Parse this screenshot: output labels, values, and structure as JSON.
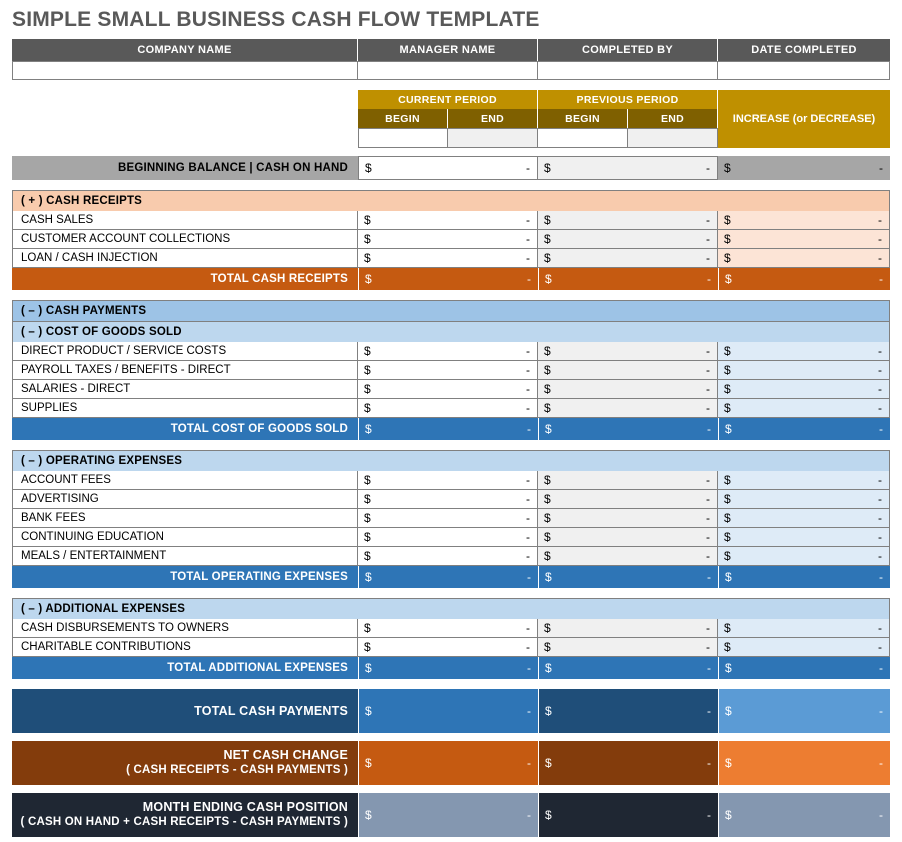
{
  "title": "SIMPLE SMALL BUSINESS CASH FLOW TEMPLATE",
  "info_header": {
    "company_name": "COMPANY NAME",
    "manager_name": "MANAGER NAME",
    "completed_by": "COMPLETED BY",
    "date_completed": "DATE COMPLETED"
  },
  "info_values": {
    "company_name": "",
    "manager_name": "",
    "completed_by": "",
    "date_completed": ""
  },
  "period_header": {
    "current_period": "CURRENT PERIOD",
    "previous_period": "PREVIOUS PERIOD",
    "begin": "BEGIN",
    "end": "END",
    "increase": "INCREASE (or DECREASE)",
    "values": {
      "current_begin": "",
      "current_end": "",
      "previous_begin": "",
      "previous_end": ""
    }
  },
  "money": {
    "symbol": "$",
    "value": "-"
  },
  "beginning_balance": {
    "label": "BEGINNING BALANCE | CASH ON HAND",
    "current": "-",
    "previous": "-",
    "increase": "-"
  },
  "sections": [
    {
      "header": "( + )  CASH RECEIPTS",
      "items": [
        {
          "label": "CASH SALES"
        },
        {
          "label": "CUSTOMER ACCOUNT COLLECTIONS"
        },
        {
          "label": "LOAN / CASH INJECTION"
        }
      ],
      "total": "TOTAL CASH RECEIPTS"
    },
    {
      "header": "( – )  CASH PAYMENTS",
      "subheader": "( – )  COST OF GOODS SOLD",
      "items": [
        {
          "label": "DIRECT PRODUCT / SERVICE COSTS"
        },
        {
          "label": "PAYROLL TAXES / BENEFITS - DIRECT"
        },
        {
          "label": "SALARIES - DIRECT"
        },
        {
          "label": "SUPPLIES"
        }
      ],
      "total": "TOTAL COST OF GOODS SOLD"
    },
    {
      "header": "( – )  OPERATING EXPENSES",
      "items": [
        {
          "label": "ACCOUNT FEES"
        },
        {
          "label": "ADVERTISING"
        },
        {
          "label": "BANK FEES"
        },
        {
          "label": "CONTINUING EDUCATION"
        },
        {
          "label": "MEALS / ENTERTAINMENT"
        }
      ],
      "total": "TOTAL OPERATING EXPENSES"
    },
    {
      "header": "( – )  ADDITIONAL EXPENSES",
      "items": [
        {
          "label": "CASH DISBURSEMENTS TO OWNERS"
        },
        {
          "label": "CHARITABLE CONTRIBUTIONS"
        }
      ],
      "total": "TOTAL ADDITIONAL EXPENSES"
    }
  ],
  "summary": {
    "total_cash_payments": {
      "label": "TOTAL CASH PAYMENTS",
      "sub": ""
    },
    "net_cash_change": {
      "label": "NET CASH CHANGE",
      "sub": "( CASH RECEIPTS - CASH PAYMENTS )"
    },
    "month_ending": {
      "label": "MONTH ENDING CASH POSITION",
      "sub": "( CASH ON HAND + CASH RECEIPTS - CASH PAYMENTS )"
    }
  },
  "colors": {
    "title": "#595959",
    "info_header": "#595959",
    "gold": "#BF9000",
    "gold_dark": "#7F6000",
    "gray": "#A6A6A6",
    "peach": "#F8CBAD",
    "peach_light": "#FCE4D6",
    "orange": "#C55A11",
    "orange_light": "#ED7D31",
    "brown": "#833C0C",
    "blue_med": "#9DC3E6",
    "blue_light": "#BDD7EE",
    "blue_pale": "#DEEBF7",
    "blue": "#2E75B6",
    "navy": "#1F4E79",
    "blue_bright": "#5B9BD5",
    "charcoal": "#1F2733",
    "slate": "#8497B0"
  }
}
